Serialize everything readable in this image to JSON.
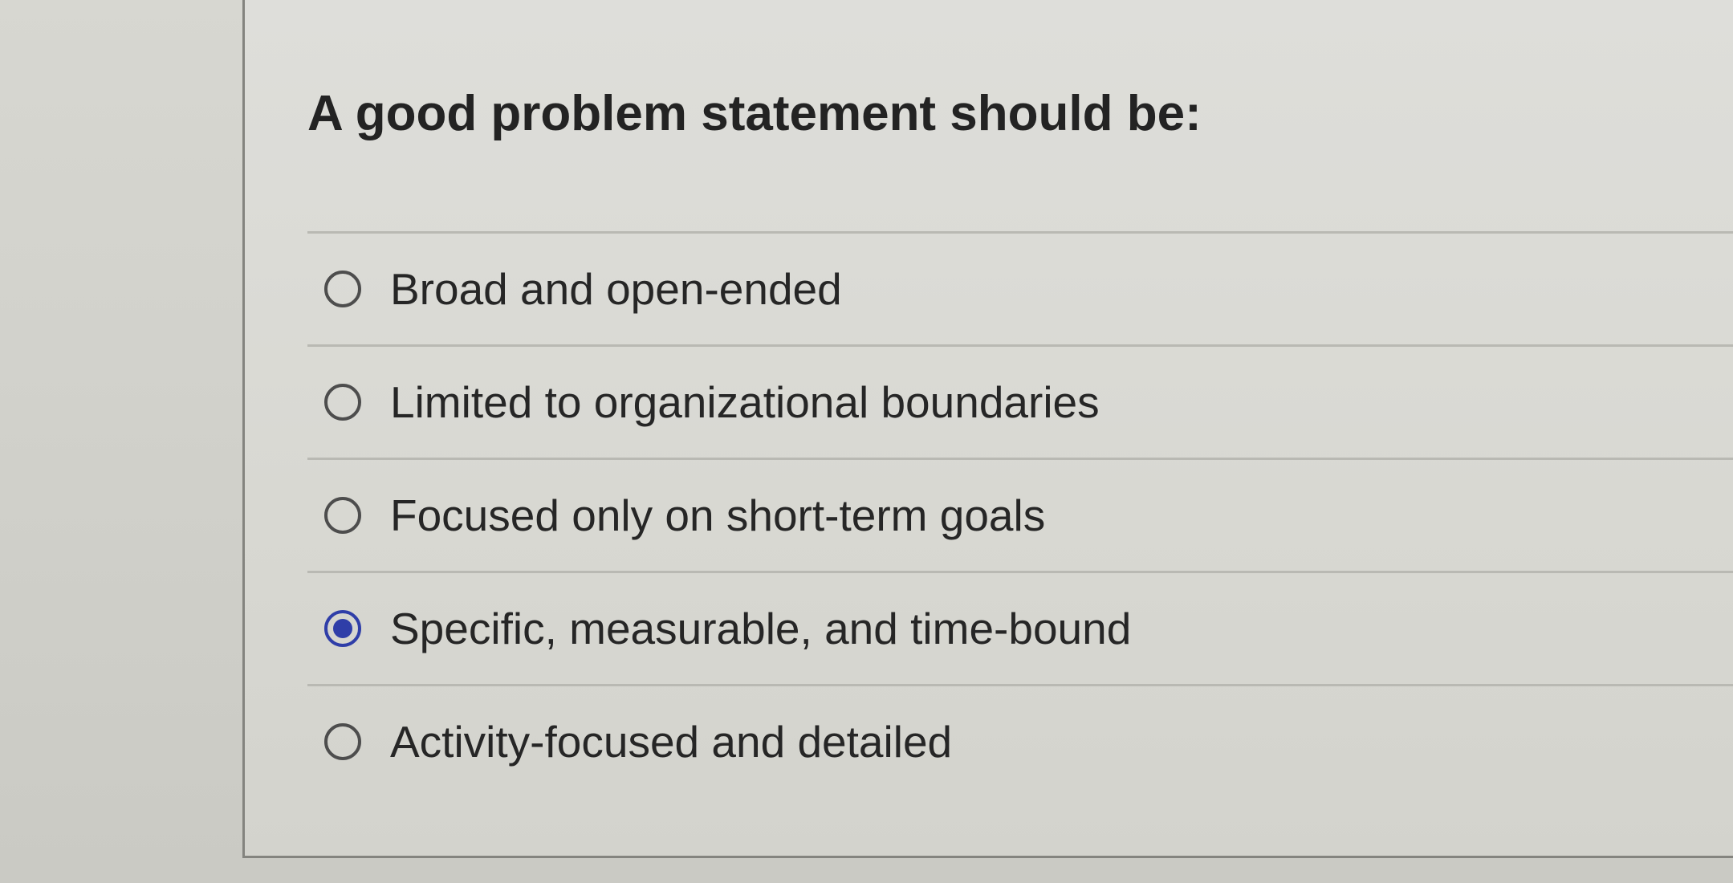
{
  "question": {
    "title": "A good problem statement should be:"
  },
  "options": [
    {
      "label": "Broad and open-ended",
      "selected": false
    },
    {
      "label": "Limited to organizational boundaries",
      "selected": false
    },
    {
      "label": "Focused only on short-term goals",
      "selected": false
    },
    {
      "label": "Specific, measurable, and time-bound",
      "selected": true
    },
    {
      "label": "Activity-focused and detailed",
      "selected": false
    }
  ],
  "colors": {
    "accent": "#2f3ea8",
    "text": "#262626",
    "background": "#d3d3cd"
  },
  "icons": {
    "unselected": "radio-unselected-icon",
    "selected": "radio-selected-icon"
  }
}
